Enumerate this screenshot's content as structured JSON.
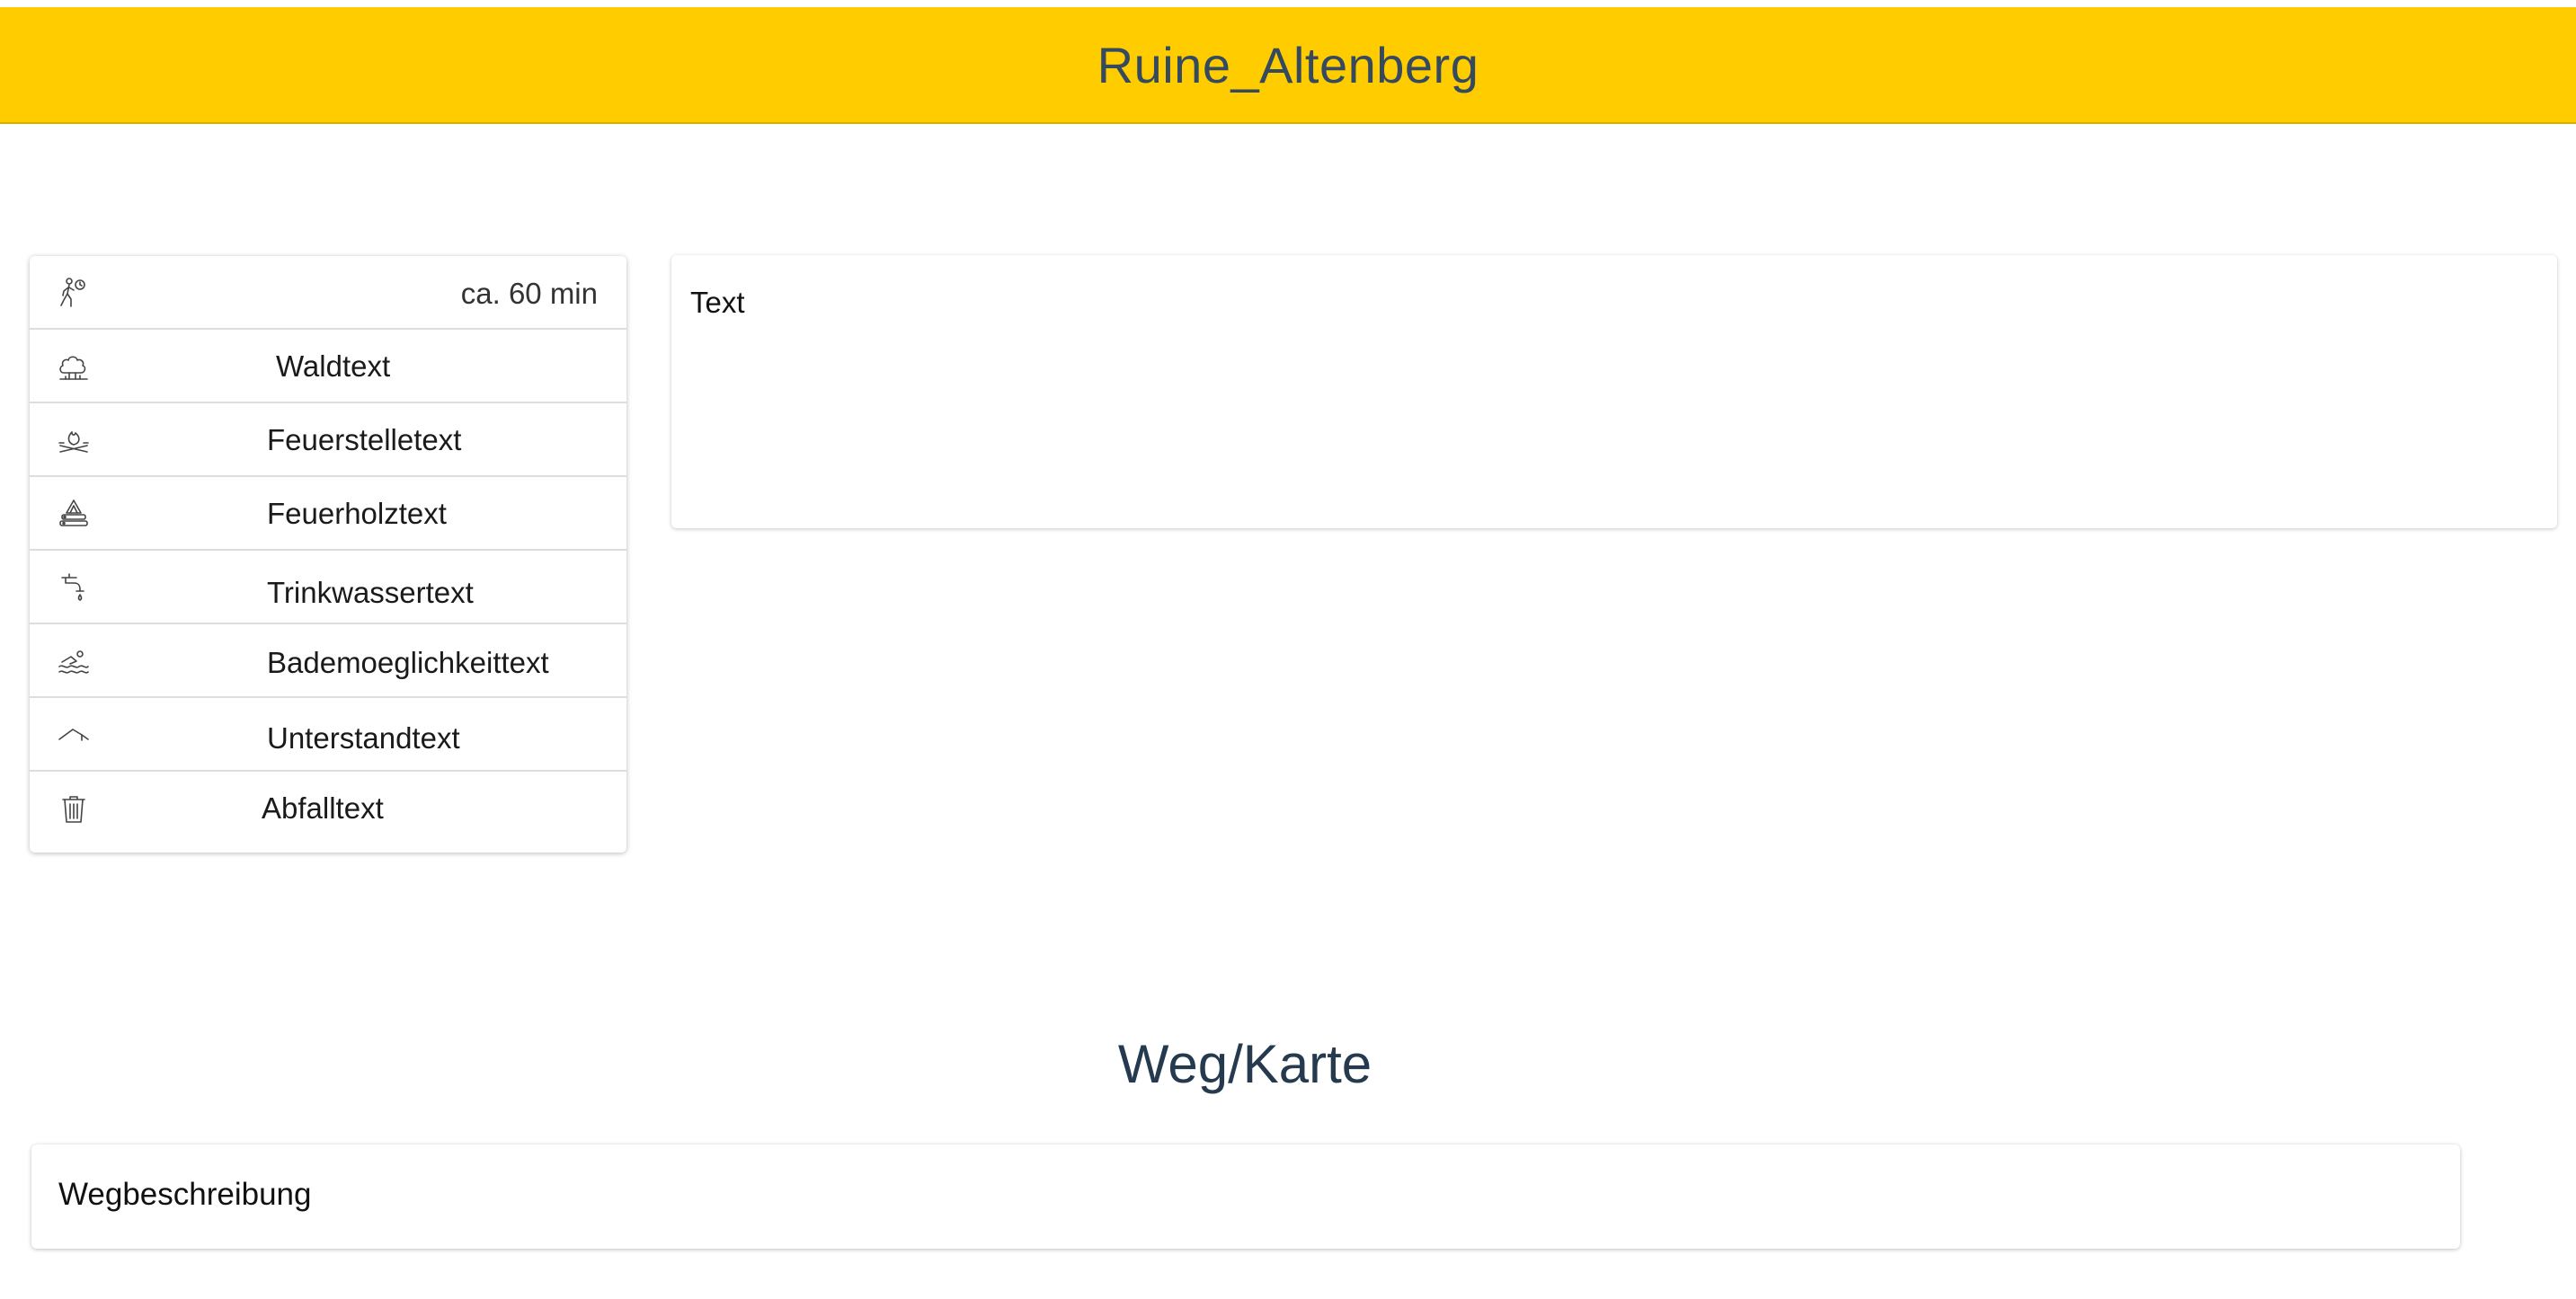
{
  "header": {
    "title": "Ruine_Altenberg"
  },
  "facts": {
    "duration": {
      "icon": "hiking-icon",
      "label": "ca. 60 min"
    },
    "items": [
      {
        "icon": "forest-icon",
        "label": "Waldtext"
      },
      {
        "icon": "campfire-icon",
        "label": "Feuerstelletext"
      },
      {
        "icon": "firewood-icon",
        "label": "Feuerholztext"
      },
      {
        "icon": "water-tap-icon",
        "label": "Trinkwassertext"
      },
      {
        "icon": "swimming-icon",
        "label": "Bademoeglichkeittext"
      },
      {
        "icon": "shelter-icon",
        "label": "Unterstandtext"
      },
      {
        "icon": "trash-icon",
        "label": "Abfalltext"
      }
    ]
  },
  "description": {
    "text": "Text"
  },
  "route": {
    "heading": "Weg/Karte",
    "description": "Wegbeschreibung"
  }
}
